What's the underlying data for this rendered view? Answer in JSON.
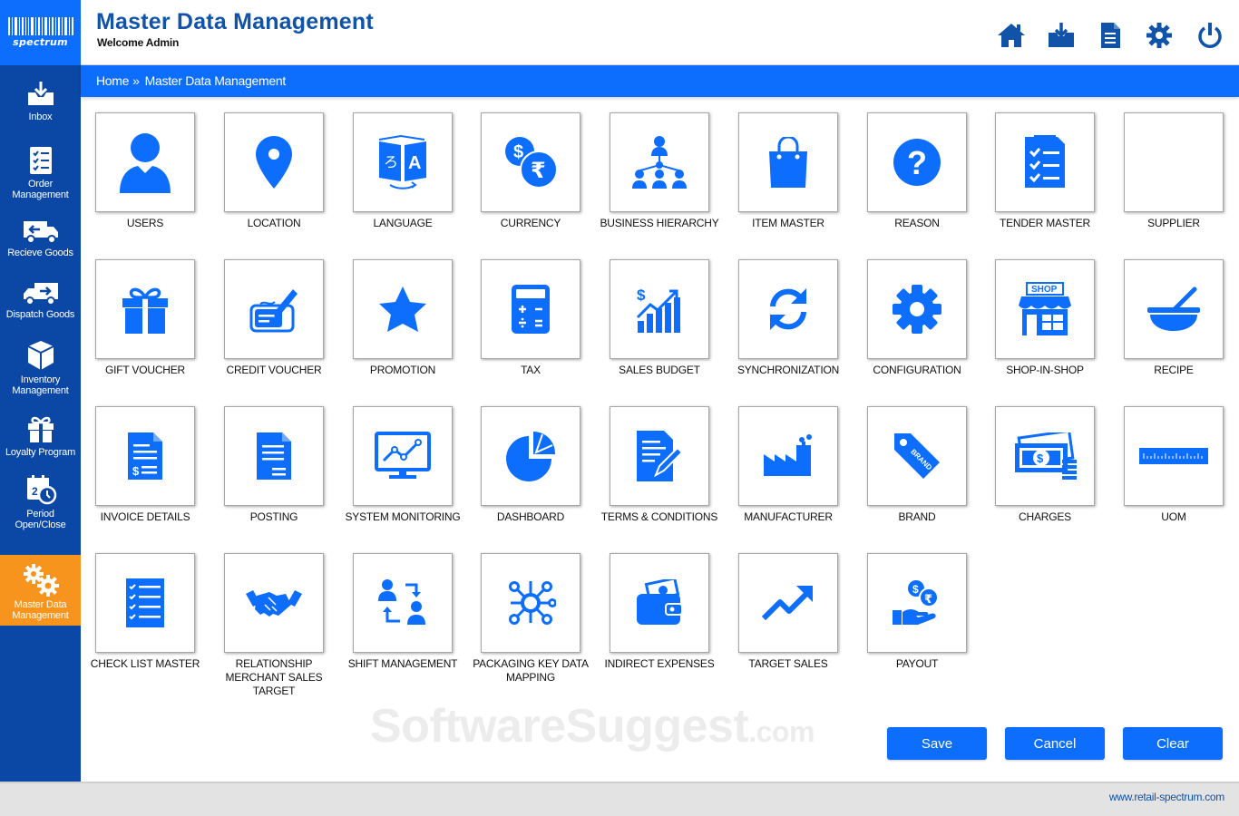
{
  "app": {
    "logo_text": "spectrum",
    "title": "Master Data Management",
    "welcome": "Welcome Admin"
  },
  "header_icons": [
    "home-icon",
    "download-icon",
    "document-icon",
    "gear-icon",
    "power-icon"
  ],
  "sidebar": {
    "items": [
      {
        "label": "Inbox",
        "icon": "inbox-icon",
        "active": false
      },
      {
        "label": "Order Management",
        "icon": "checklist-icon",
        "active": false
      },
      {
        "label": "Recieve Goods",
        "icon": "truck-icon",
        "active": false
      },
      {
        "label": "Dispatch Goods",
        "icon": "dispatch-truck-icon",
        "active": false
      },
      {
        "label": "Inventory Management",
        "icon": "boxes-icon",
        "active": false
      },
      {
        "label": "Loyalty Program",
        "icon": "gift-icon",
        "active": false
      },
      {
        "label": "Period Open/Close",
        "icon": "calendar-clock-icon",
        "active": true
      },
      {
        "label": "Master Data Management",
        "icon": "gears-icon",
        "active": true
      }
    ]
  },
  "breadcrumb": {
    "home": "Home",
    "separator": "»",
    "current": "Master Data Management"
  },
  "tiles": [
    {
      "label": "USERS",
      "icon": "user-icon"
    },
    {
      "label": "LOCATION",
      "icon": "location-pin-icon"
    },
    {
      "label": "LANGUAGE",
      "icon": "translate-icon"
    },
    {
      "label": "CURRENCY",
      "icon": "currency-icon"
    },
    {
      "label": "BUSINESS HIERARCHY",
      "icon": "hierarchy-icon"
    },
    {
      "label": "ITEM MASTER",
      "icon": "shopping-bag-icon"
    },
    {
      "label": "REASON",
      "icon": "question-icon"
    },
    {
      "label": "TENDER MASTER",
      "icon": "checklist-doc-icon"
    },
    {
      "label": "SUPPLIER",
      "icon": "blank-icon"
    },
    {
      "label": "GIFT VOUCHER",
      "icon": "gift-box-icon"
    },
    {
      "label": "CREDIT VOUCHER",
      "icon": "signed-voucher-icon"
    },
    {
      "label": "PROMOTION",
      "icon": "star-icon"
    },
    {
      "label": "TAX",
      "icon": "calculator-icon"
    },
    {
      "label": "SALES BUDGET",
      "icon": "bar-growth-icon"
    },
    {
      "label": "SYNCHRONIZATION",
      "icon": "sync-icon"
    },
    {
      "label": "CONFIGURATION",
      "icon": "cog-icon"
    },
    {
      "label": "SHOP-IN-SHOP",
      "icon": "shop-icon"
    },
    {
      "label": "RECIPE",
      "icon": "mortar-bowl-icon"
    },
    {
      "label": "INVOICE DETAILS",
      "icon": "invoice-icon"
    },
    {
      "label": "POSTING",
      "icon": "posting-doc-icon"
    },
    {
      "label": "SYSTEM MONITORING",
      "icon": "monitor-chart-icon"
    },
    {
      "label": "DASHBOARD",
      "icon": "pie-chart-icon"
    },
    {
      "label": "TERMS & CONDITIONS",
      "icon": "doc-pen-icon"
    },
    {
      "label": "MANUFACTURER",
      "icon": "factory-icon"
    },
    {
      "label": "BRAND",
      "icon": "brand-tag-icon"
    },
    {
      "label": "CHARGES",
      "icon": "cash-stack-icon"
    },
    {
      "label": "UOM",
      "icon": "ruler-icon"
    },
    {
      "label": "CHECK LIST MASTER",
      "icon": "checklist-lines-icon"
    },
    {
      "label": "RELATIONSHIP MERCHANT SALES TARGET",
      "icon": "handshake-icon"
    },
    {
      "label": "SHIFT MANAGEMENT",
      "icon": "shift-users-icon"
    },
    {
      "label": "PACKAGING KEY DATA MAPPING",
      "icon": "network-nodes-icon"
    },
    {
      "label": "INDIRECT EXPENSES",
      "icon": "wallet-icon"
    },
    {
      "label": "TARGET SALES",
      "icon": "trend-up-icon"
    },
    {
      "label": "PAYOUT",
      "icon": "payout-hand-icon"
    }
  ],
  "watermark": {
    "main": "SoftwareSuggest",
    "suffix": ".com"
  },
  "actions": {
    "save": "Save",
    "cancel": "Cancel",
    "clear": "Clear"
  },
  "footer": {
    "url": "www.retail-spectrum.com"
  },
  "colors": {
    "primary": "#0d6efd",
    "sidebar": "#0b47a5",
    "active": "#f7941d",
    "title": "#1053a9"
  }
}
